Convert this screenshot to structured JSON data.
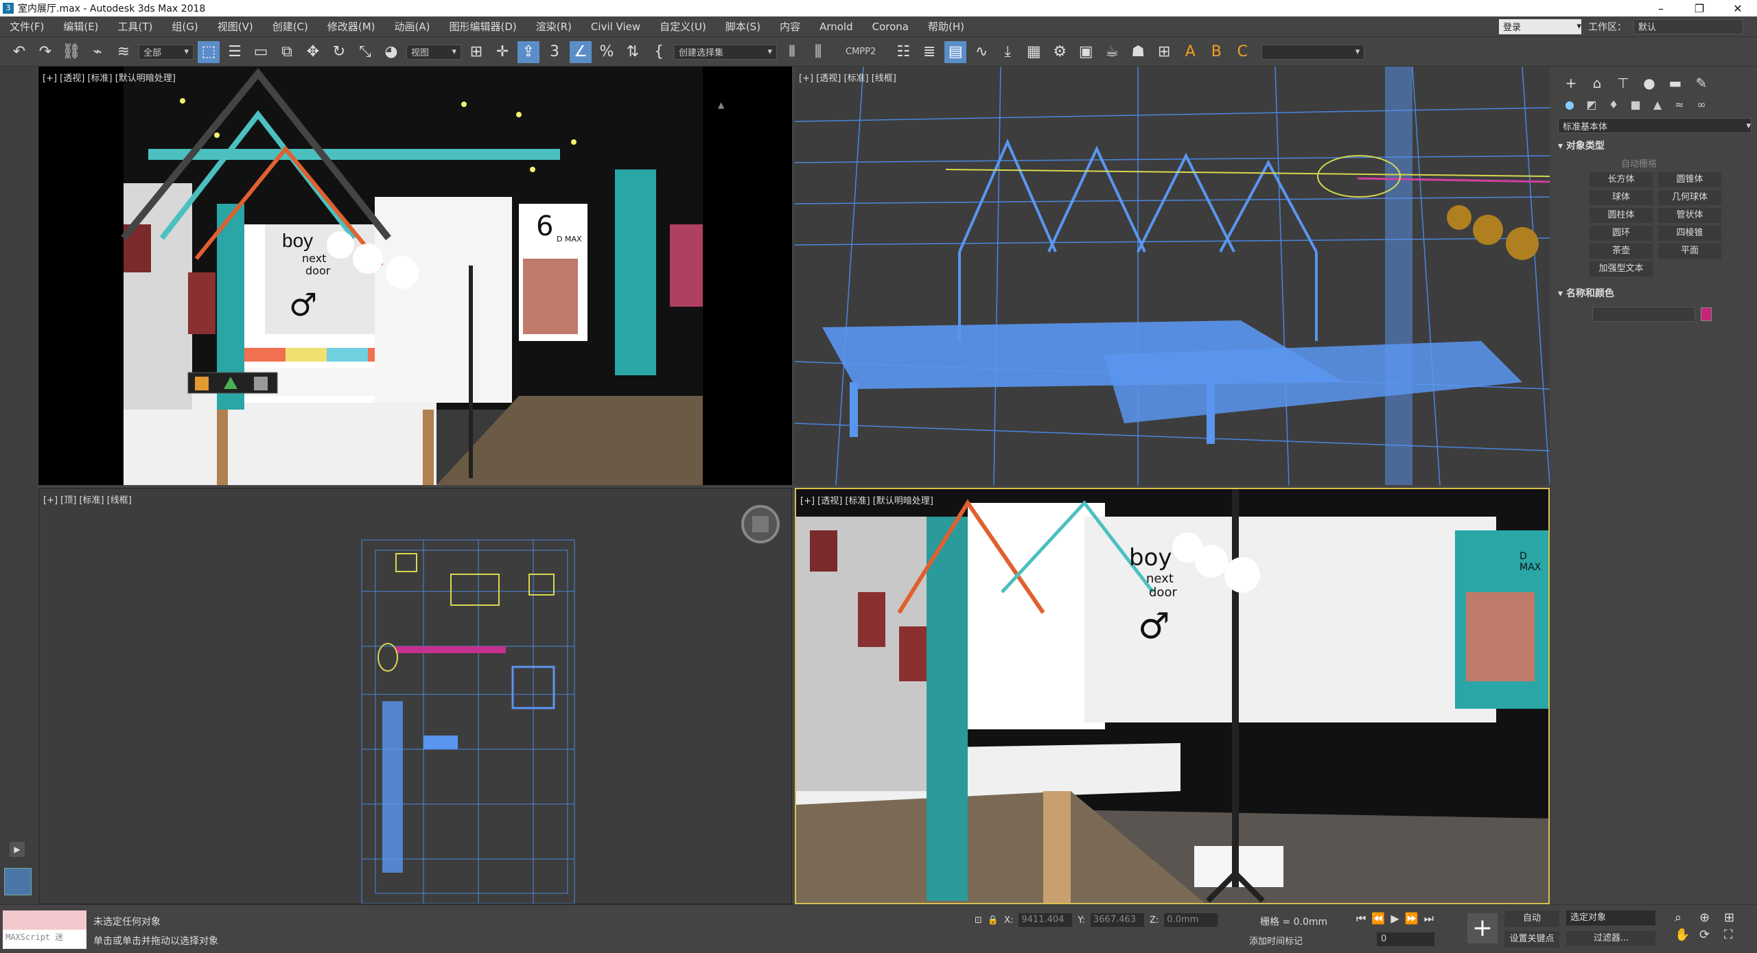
{
  "title": "室内展厅.max - Autodesk 3ds Max 2018",
  "menu": [
    "文件(F)",
    "编辑(E)",
    "工具(T)",
    "组(G)",
    "视图(V)",
    "创建(C)",
    "修改器(M)",
    "动画(A)",
    "图形编辑器(D)",
    "渲染(R)",
    "Civil View",
    "自定义(U)",
    "脚本(S)",
    "内容",
    "Arnold",
    "Corona",
    "帮助(H)"
  ],
  "login_label": "登录",
  "workspace_label": "工作区：",
  "workspace_value": "默认",
  "toolbar": {
    "selection_filter": "全部",
    "coord_system": "视图",
    "named_selection": "创建选择集",
    "cmpp2": "CMPP2"
  },
  "viewports": {
    "top_left_label": "[+] [透视] [标准] [默认明暗处理]",
    "top_right_label": "[+] [透视] [标准] [线框]",
    "bottom_left_label": "[+] [顶] [标准] [线框]",
    "bottom_right_label": "[+] [透视] [标准] [默认明暗处理]"
  },
  "scene_text": {
    "boy": "boy",
    "next": "next",
    "door": "door",
    "six": "6",
    "dmax": "D MAX",
    "male_symbol": "♂"
  },
  "command_panel": {
    "dropdown": "标准基本体",
    "rollout1": "对象类型",
    "autogrid": "自动栅格",
    "objects": [
      "长方体",
      "圆锥体",
      "球体",
      "几何球体",
      "圆柱体",
      "管状体",
      "圆环",
      "四棱锥",
      "茶壶",
      "平面",
      "加强型文本"
    ],
    "rollout2": "名称和颜色",
    "object_color": "#c8237a"
  },
  "status": {
    "maxscript": "MAXScript 迷",
    "line1": "未选定任何对象",
    "line2": "单击或单击并拖动以选择对象",
    "x_label": "X:",
    "x_value": "9411.404",
    "y_label": "Y:",
    "y_value": "3667.463",
    "z_label": "Z:",
    "z_value": "0.0mm",
    "grid": "栅格 = 0.0mm",
    "add_time_tag": "添加时间标记",
    "frame": "0",
    "auto": "自动",
    "set_key": "设置关键点",
    "selected_object": "选定对象",
    "filters": "过滤器..."
  }
}
